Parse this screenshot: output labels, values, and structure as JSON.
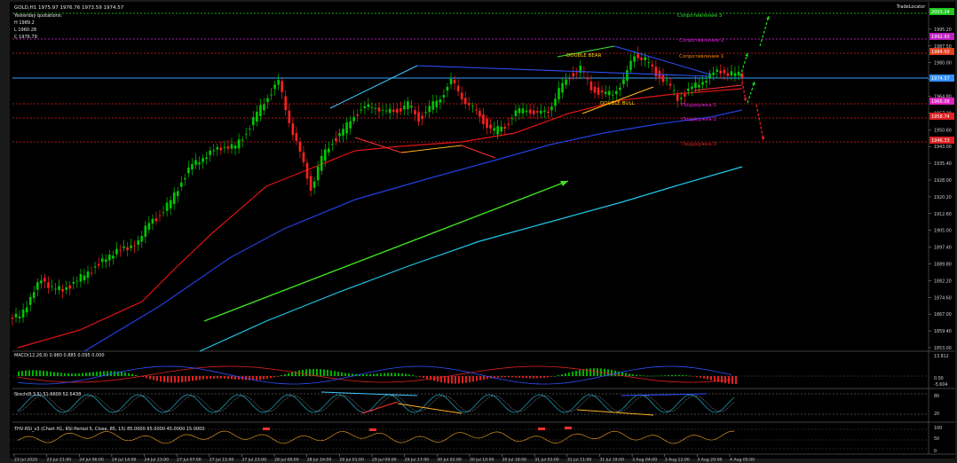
{
  "window": {
    "symbol_header": "GOLD,H1  1975.97 1976.76 1973.59 1974.57",
    "yesterday_title": "Yesterday quotations:",
    "yesterday_lines": [
      "H 1989.2",
      "L 1960.28",
      "C 1976.79"
    ],
    "trade_locator": "TradeLocator"
  },
  "colors": {
    "background": "#000000",
    "frame": "#1a1a1a",
    "bull_candle": "#00c800",
    "bear_candle": "#ff2020",
    "ma_red": "#e01414",
    "ma_blue": "#2040e0",
    "ma_cyan": "#20c8e8",
    "trend_green": "#40e020",
    "pivot_line": "#3aa0ff",
    "resist": "#e02020",
    "support": "#e02020",
    "label_green": "#20e020",
    "label_magenta": "#e020e0",
    "label_orange": "#ff8c00",
    "label_yellow": "#ffd000"
  },
  "chart_data": [
    {
      "type": "candlestick",
      "title": "GOLD,H1",
      "ylim": [
        1853.0,
        2004.0
      ],
      "y_ticks": [
        "2002.90",
        "1995.20",
        "1987.50",
        "1980.00",
        "1972.40",
        "1964.80",
        "1957.20",
        "1950.60",
        "1943.00",
        "1935.40",
        "1928.00",
        "1920.20",
        "1912.60",
        "1905.00",
        "1897.40",
        "1889.80",
        "1882.20",
        "1874.60",
        "1867.00",
        "1859.40",
        "1853.00"
      ],
      "x_ticks": [
        "23 Jul 2020",
        "23 Jul 21:00",
        "24 Jul 06:00",
        "24 Jul 14:00",
        "24 Jul 23:00",
        "27 Jul 07:00",
        "27 Jul 15:00",
        "27 Jul 23:00",
        "28 Jul 08:00",
        "28 Jul 16:00",
        "29 Jul 01:00",
        "29 Jul 09:00",
        "29 Jul 17:00",
        "30 Jul 02:00",
        "30 Jul 10:00",
        "30 Jul 18:00",
        "31 Jul 03:00",
        "31 Jul 11:00",
        "31 Jul 19:00",
        "3 Aug 04:00",
        "3 Aug 12:00",
        "3 Aug 20:00",
        "4 Aug 05:00"
      ],
      "price_tags": [
        "2003.24",
        "1992.93",
        "1984.50",
        "1974.57",
        "1966.08",
        "1958.74",
        "1946.33"
      ],
      "close_path": [
        1868,
        1876,
        1884,
        1881,
        1879,
        1883,
        1886,
        1890,
        1893,
        1898,
        1897,
        1902,
        1909,
        1913,
        1919,
        1928,
        1935,
        1939,
        1941,
        1944,
        1943,
        1950,
        1958,
        1966,
        1972,
        1955,
        1940,
        1925,
        1938,
        1946,
        1950,
        1958,
        1960,
        1962,
        1958,
        1960,
        1962,
        1956,
        1960,
        1966,
        1972,
        1966,
        1960,
        1955,
        1950,
        1953,
        1958,
        1961,
        1957,
        1960,
        1968,
        1975,
        1978,
        1970,
        1966,
        1968,
        1972,
        1985,
        1982,
        1976,
        1972,
        1965,
        1968,
        1972,
        1975,
        1977,
        1976,
        1975
      ],
      "annotations": [
        {
          "text": "DOUBLE  BEAR",
          "color": "#ffd000"
        },
        {
          "text": "DOUBLE  BULL",
          "color": "#ffd000"
        },
        {
          "text": "Сопротивление 3",
          "color": "#20e020"
        },
        {
          "text": "Сопротивление 2",
          "color": "#e020e0"
        },
        {
          "text": "Сопротивление 1",
          "color": "#ff8c00"
        },
        {
          "text": "Поддержка 1",
          "color": "#e020e0"
        },
        {
          "text": "Поддержка 2",
          "color": "#e020e0"
        },
        {
          "text": "Поддержка 3",
          "color": "#e02020"
        }
      ]
    },
    {
      "type": "bar",
      "title": "MACD(12,26,9) 0.980 0.885 0.095 0.000",
      "y_ticks": [
        "13.812",
        "0.00",
        "-5.604"
      ]
    },
    {
      "type": "line",
      "title": "Stoch(8,3,5) 51.6600 52.5438",
      "y_ticks": [
        "80",
        "20"
      ]
    },
    {
      "type": "line",
      "title": "THV RSI_v3  (Chart H1, RSI Period 5, Close, 85, 15)  85.0000 65.0000 45.0000 15.0000",
      "y_ticks": [
        "100",
        "50",
        "0"
      ]
    }
  ]
}
